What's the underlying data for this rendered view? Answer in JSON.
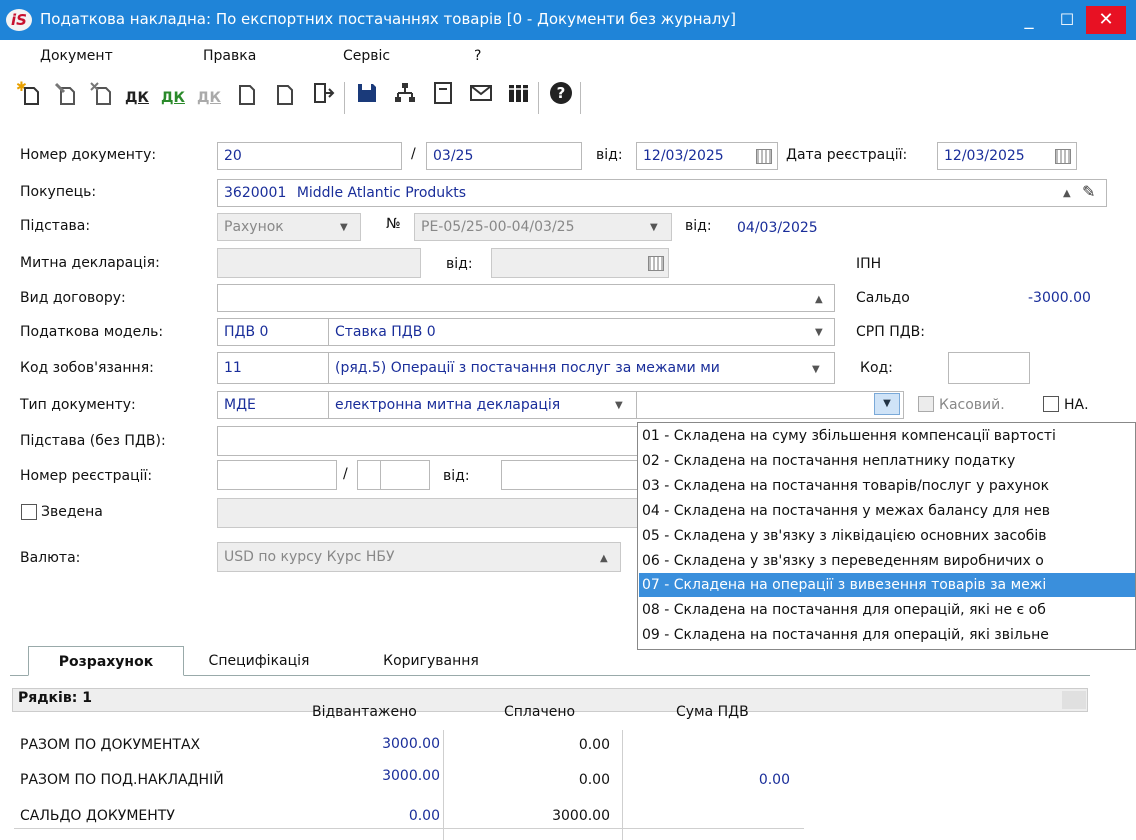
{
  "window": {
    "logo_text": "iS",
    "title": "Податкова накладна: По експортних  постачаннях товарів [0 - Документи без журналу]",
    "minimize_glyph": "_",
    "maximize_glyph": "☐",
    "close_glyph": "✕"
  },
  "menu": [
    "Документ",
    "Правка",
    "Сервіс",
    "?"
  ],
  "toolbar": {
    "dk1": "ДК",
    "dk2": "ДК",
    "dk3": "ДК",
    "icons": [
      "new-doc-icon",
      "copy-doc-icon",
      "delete-doc-icon",
      "dk-icon",
      "dk-up-icon",
      "dk-disabled-icon",
      "doc-icon",
      "doc2-icon",
      "exit-icon",
      "save-icon",
      "tree-icon",
      "form-icon",
      "mail-icon",
      "books-icon",
      "help-icon"
    ]
  },
  "form": {
    "doc_number_label": "Номер документу:",
    "doc_number": "20",
    "slash": "/",
    "doc_number_suffix": "03/25",
    "from_label": "від:",
    "doc_date": "12/03/2025",
    "reg_date_label": "Дата реєстрації:",
    "reg_date": "12/03/2025",
    "buyer_label": "Покупець:",
    "buyer_code": "3620001",
    "buyer_name": "Middle Atlantic Produkts",
    "basis_label": "Підстава:",
    "basis_value": "Рахунок",
    "no_label": "№",
    "basis_number": "РЕ-05/25-00-04/03/25",
    "basis_from_label": "від:",
    "basis_date": "04/03/2025",
    "customs_label": "Митна декларація:",
    "customs_from_label": "від:",
    "ipn_label": "ІПН",
    "contract_type_label": "Вид договору:",
    "saldo_label": "Сальдо",
    "saldo_value": "-3000.00",
    "tax_model_label": "Податкова модель:",
    "tax_model_code": "ПДВ  0",
    "tax_model_name": "Ставка ПДВ 0",
    "srp_label": "СРП ПДВ:",
    "obligation_label": "Код зобов'язання:",
    "obligation_code": "11",
    "obligation_name": "(ряд.5) Операції з постачання послуг за межами ми",
    "code_label": "Код:",
    "doc_type_label": "Тип документу:",
    "doc_type_code": "МДЕ",
    "doc_type_name": "електронна митна декларація",
    "cash_label": "Касовий.",
    "na_label": "НА.",
    "basis_no_vat_label": "Підстава (без ПДВ):",
    "reg_number_label": "Номер реєстрації:",
    "reg_slash": "/",
    "reg_from_label": "від:",
    "consolidated_label": "Зведена",
    "currency_label": "Валюта:",
    "currency_value": "USD по курсу Курс НБУ"
  },
  "dropdown": {
    "items": [
      "01 - Складена на суму збільшення компенсації вартості",
      "02 - Складена на постачання неплатнику податку",
      "03 - Складена на постачання товарів/послуг у рахунок",
      "04 - Складена на постачання у межах балансу для нев",
      "05 - Складена у зв'язку з ліквідацією основних засобів",
      "06 - Складена у зв'язку з переведенням виробничих о",
      "07 - Складена на операції з вивезення товарів за межі",
      "08 - Складена на постачання для операцій, які не є об",
      "09 - Складена на постачання для операцій, які звільне"
    ],
    "selected_index": 6
  },
  "tabs": [
    "Розрахунок",
    "Специфікація",
    "Коригування"
  ],
  "table": {
    "rows_label": "Рядків: 1",
    "headers": [
      "Відвантажено",
      "Сплачено",
      "Сума ПДВ"
    ],
    "rows": [
      {
        "label": "РАЗОМ ПО ДОКУМЕНТАХ",
        "shipped": "3000.00",
        "paid": "0.00",
        "vat": ""
      },
      {
        "label": "РАЗОМ ПО ПОД.НАКЛАДНІЙ",
        "shipped": "3000.00",
        "paid": "0.00",
        "vat": "0.00"
      },
      {
        "label": "САЛЬДО ДОКУМЕНТУ",
        "shipped": "0.00",
        "paid": "3000.00",
        "vat": ""
      }
    ]
  }
}
